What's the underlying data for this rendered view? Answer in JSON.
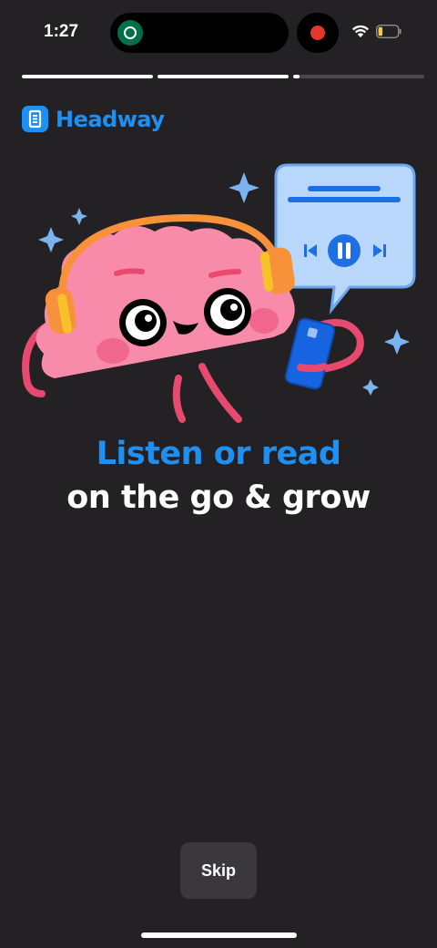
{
  "status_bar": {
    "time": "1:27",
    "island_app_icon": "starbucks-icon",
    "recording_icon": "recording-dot-icon",
    "wifi_icon": "wifi-icon",
    "battery_icon": "battery-icon"
  },
  "stories_progress": {
    "segments": [
      {
        "progress": 1.0
      },
      {
        "progress": 1.0
      },
      {
        "progress": 0.05
      }
    ]
  },
  "brand": {
    "name": "Headway",
    "logo_icon": "headway-logo-icon",
    "accent_color": "#1e90f4"
  },
  "illustration": {
    "subject": "brain-with-headphones-illustration"
  },
  "onboarding": {
    "headline_accent": "Listen or read",
    "headline_main": "on the go & grow"
  },
  "actions": {
    "skip_label": "Skip"
  },
  "colors": {
    "background": "#232124",
    "button_bg": "#3a383c"
  }
}
